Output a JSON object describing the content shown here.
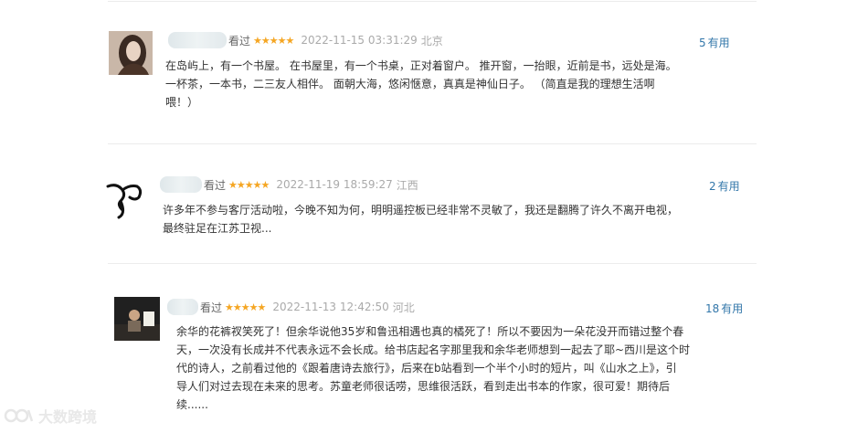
{
  "comments": [
    {
      "seen": "看过",
      "stars": "★★★★★",
      "time": "2022-11-15 03:31:29",
      "location": "北京",
      "useful_count": "5",
      "useful_label": "有用",
      "lines": [
        "在岛屿上，有一个书屋。 在书屋里，有一个书桌，正对着窗户。 推开窗，一抬眼，近前是书，远处是海。",
        "一杯茶，一本书，二三友人相伴。 面朝大海，悠闲惬意，真真是神仙日子。 （简直是我的理想生活啊",
        "喂！）"
      ]
    },
    {
      "seen": "看过",
      "stars": "★★★★★",
      "time": "2022-11-19 18:59:27",
      "location": "江西",
      "useful_count": "2",
      "useful_label": "有用",
      "lines": [
        "许多年不参与客厅活动啦，今晚不知为何，明明遥控板已经非常不灵敏了，我还是翻腾了许久不离开电视，",
        "最终驻足在江苏卫视..."
      ]
    },
    {
      "seen": "看过",
      "stars": "★★★★★",
      "time": "2022-11-13 12:42:50",
      "location": "河北",
      "useful_count": "18",
      "useful_label": "有用",
      "lines": [
        "余华的花裤衩笑死了！但余华说他35岁和鲁迅相遇也真的橘死了！所以不要因为一朵花没开而错过整个春",
        "天，一次没有长成并不代表永远不会长成。给书店起名字那里我和余华老师想到一起去了耶~西川是这个时",
        "代的诗人，之前看过他的《跟着唐诗去旅行》，后来在b站看到一个半个小时的短片，叫《山水之上》，引",
        "导人们对过去现在未来的思考。苏童老师很话唠，思维很活跃，看到走出书本的作家，很可爱！期待后",
        "续......"
      ]
    }
  ],
  "watermark": {
    "text": "大数跨境"
  }
}
